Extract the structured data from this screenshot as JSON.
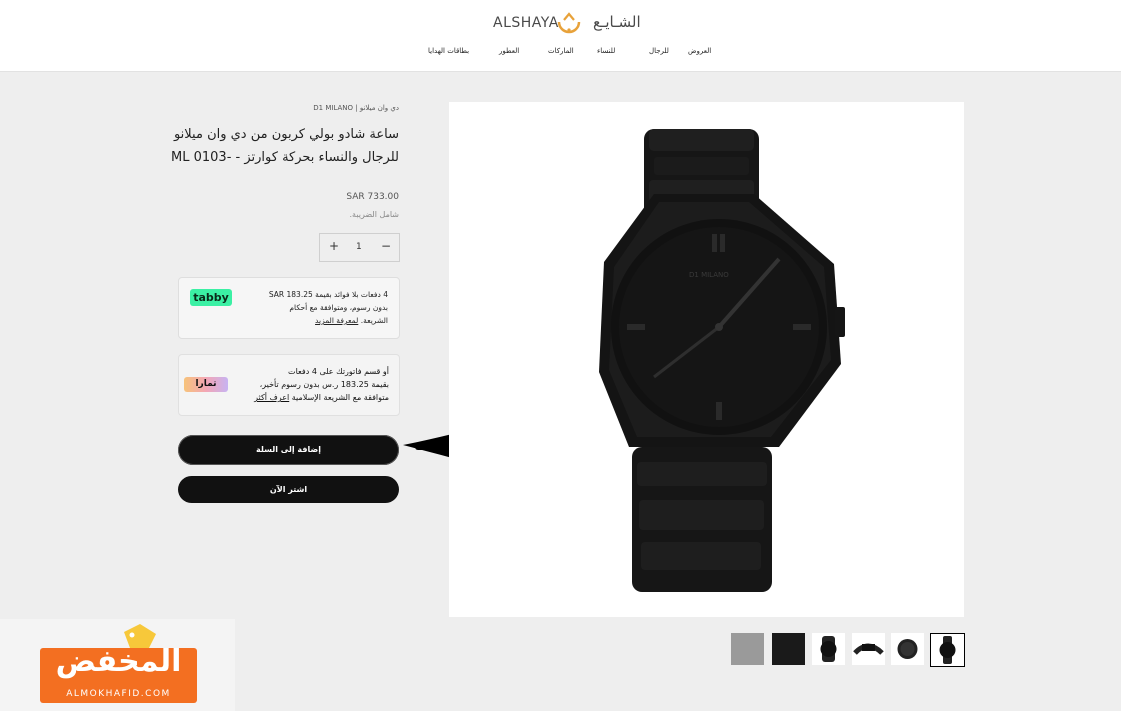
{
  "header": {
    "logo_en": "ALSHAYA",
    "logo_ar": "الشـايـع",
    "nav": [
      "العروض",
      "للرجال",
      "للنساء",
      "الماركات",
      "العطور",
      "بطاقات الهدايا"
    ]
  },
  "product": {
    "brand": "دي وان ميلانو | D1 MILANO",
    "title": "ساعة شادو بولي كربون من دي وان ميلانو للرجال والنساء بحركة كوارتز - -ML 0103",
    "price": "SAR 733.00",
    "tax_note": "شامل الضريبة.",
    "quantity": "1",
    "qty_plus": "+",
    "qty_minus": "−"
  },
  "tabby": {
    "logo": "tabby",
    "line1": "4 دفعات بلا فوائد بقيمة SAR 183.25",
    "line2": "بدون رسوم، ومتوافقة مع أحكام",
    "line3": "الشريعة.",
    "link": "لمعرفة المزيد"
  },
  "tamara": {
    "logo": "تمارا",
    "line1": "أو قسم فاتورتك على 4 دفعات",
    "line2": "بقيمة 183.25 ر.س بدون رسوم تأخير،",
    "line3": "متوافقة مع الشريعة الإسلامية",
    "link": "اعرف أكثر"
  },
  "buttons": {
    "add_to_cart": "إضافة إلى السلة",
    "buy_now": "اشتر الآن"
  },
  "watch_dial_text": "D1 MILANO",
  "watermark": {
    "ar": "المخفض",
    "en": "ALMOKHAFID.COM"
  },
  "colors": {
    "tabby_green": "#3bf0a4",
    "button_black": "#111111",
    "watermark_orange": "#f36f21"
  }
}
